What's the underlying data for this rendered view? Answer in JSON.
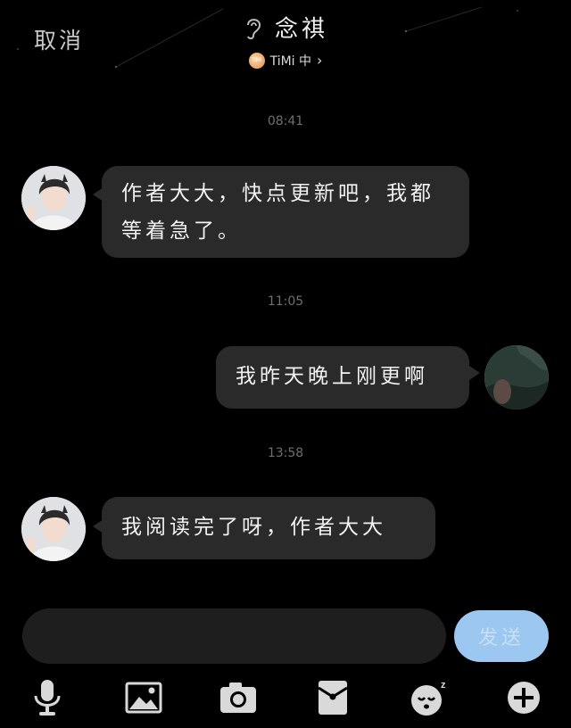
{
  "header": {
    "cancel_label": "取消",
    "title": "念祺",
    "subtitle": "TiMi 中",
    "subtitle_icon": "timi-game-icon",
    "chevron": "›"
  },
  "messages": [
    {
      "time": "08:41",
      "side": "left",
      "text": "作者大大，快点更新吧，我都等着急了。"
    },
    {
      "time": "11:05",
      "side": "right",
      "text": "我昨天晚上刚更啊"
    },
    {
      "time": "13:58",
      "side": "left",
      "text": "我阅读完了呀，作者大大"
    }
  ],
  "input": {
    "value": "",
    "placeholder": ""
  },
  "send_label": "发送",
  "toolbar": [
    "microphone-icon",
    "image-icon",
    "camera-icon",
    "red-packet-icon",
    "emoji-icon",
    "plus-icon"
  ],
  "colors": {
    "background": "#000000",
    "bubble": "#2a2a2a",
    "send": "#9bc7f0"
  }
}
